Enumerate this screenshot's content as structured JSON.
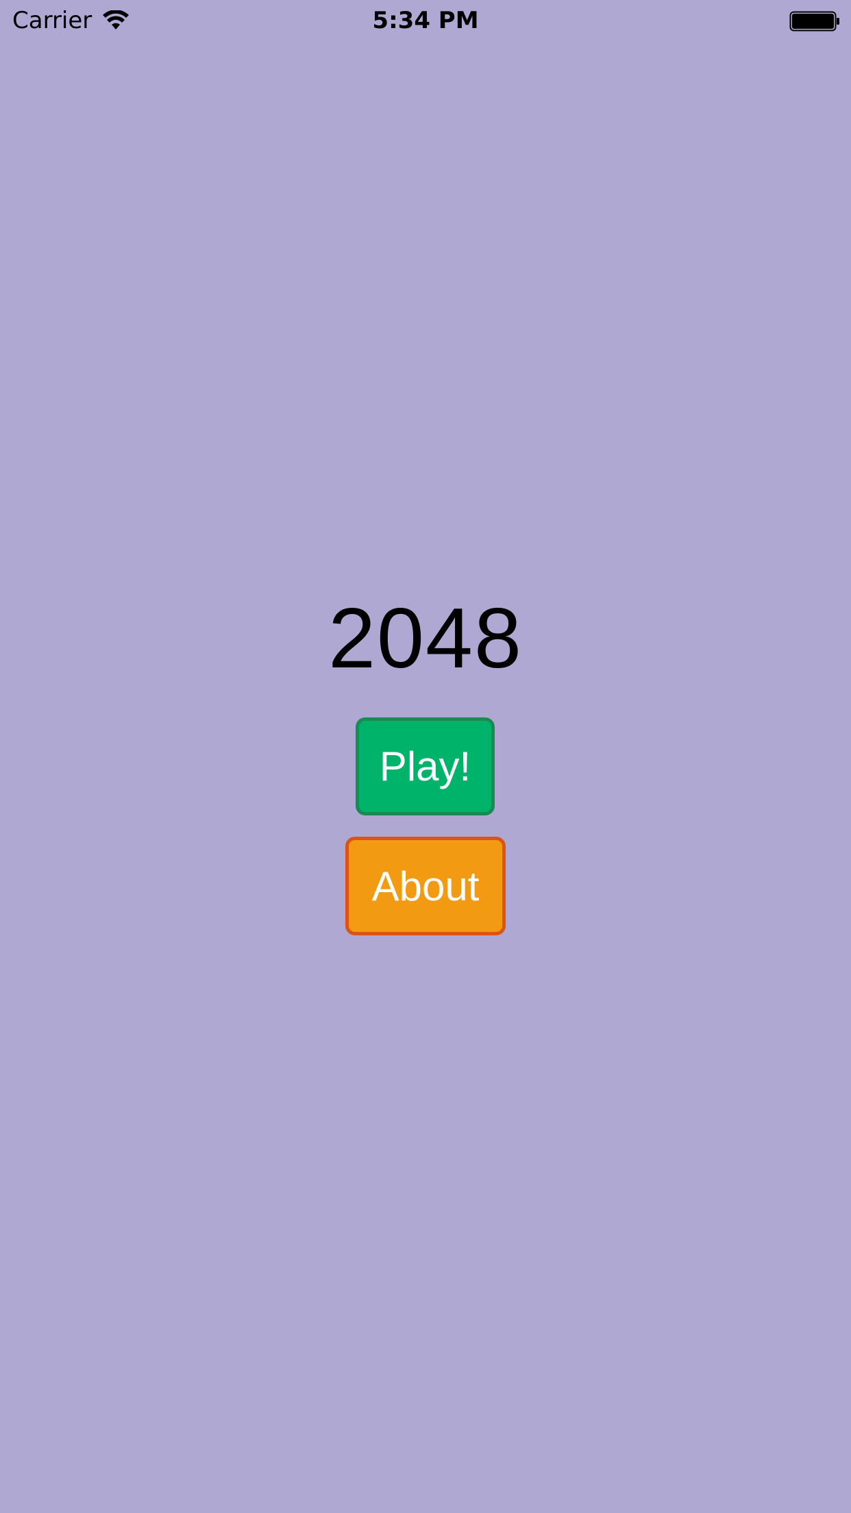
{
  "status_bar": {
    "carrier": "Carrier",
    "time": "5:34 PM",
    "wifi_icon": "wifi-icon",
    "battery_icon": "battery-full-icon"
  },
  "app": {
    "title": "2048",
    "play_label": "Play!",
    "about_label": "About"
  },
  "colors": {
    "background": "#afa8d3",
    "play_fill": "#00b36b",
    "play_border": "#1a8a52",
    "about_fill": "#f29b12",
    "about_border": "#d95415"
  }
}
